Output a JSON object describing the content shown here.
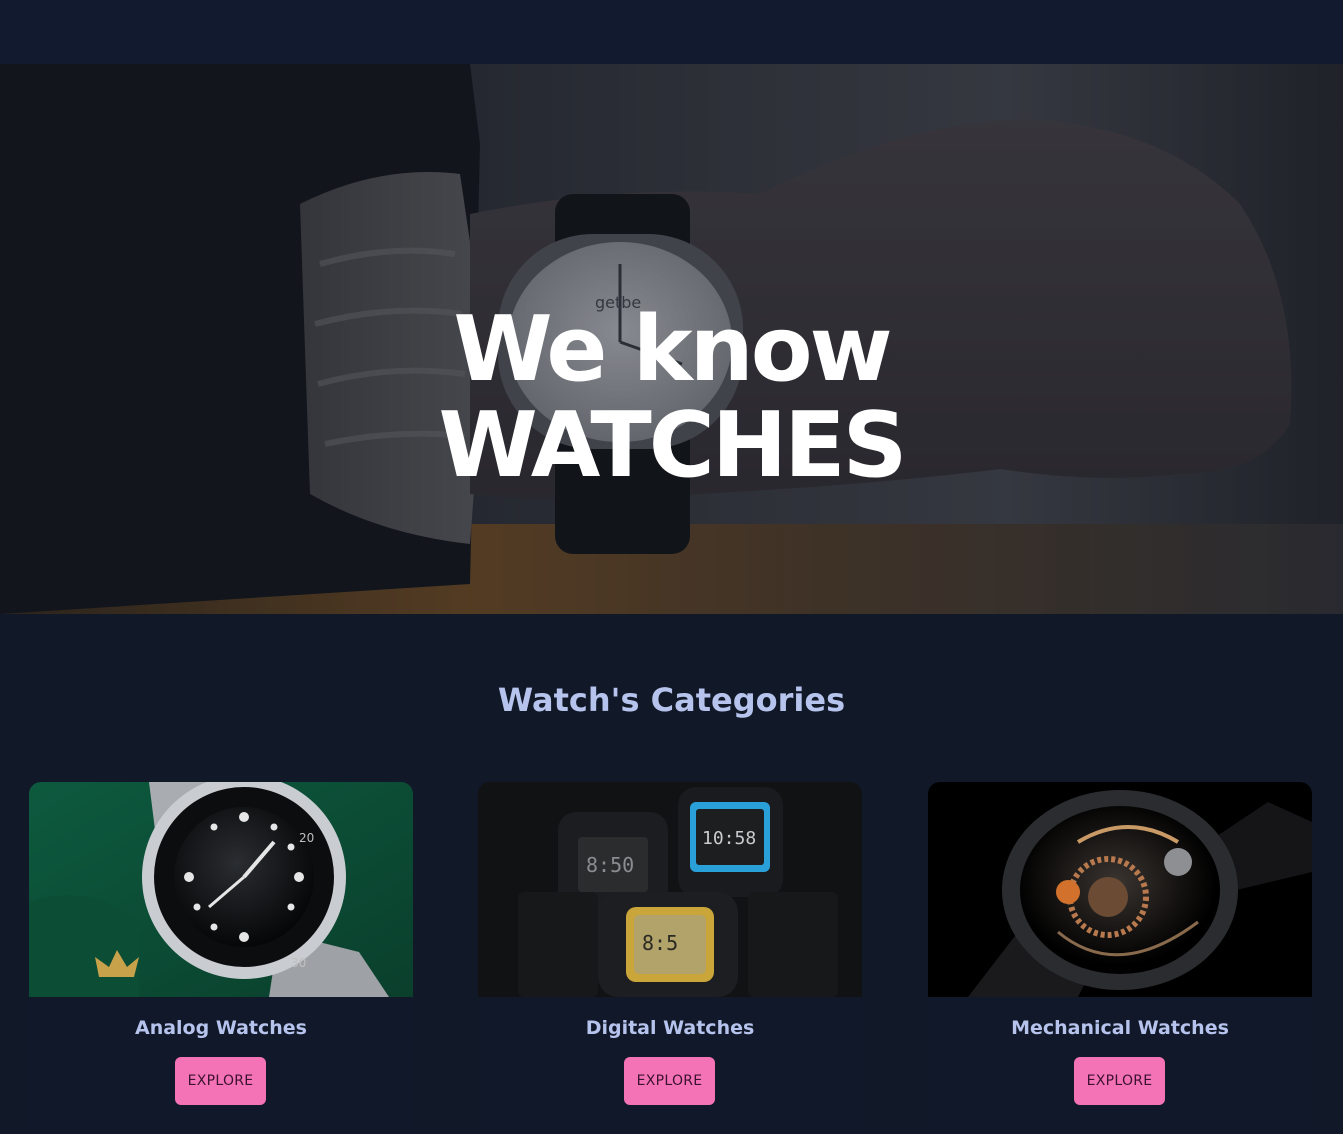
{
  "hero": {
    "title_line1": "We know",
    "title_line2": "WATCHES",
    "watch_logo_text": "getbe"
  },
  "categories": {
    "heading": "Watch's Categories",
    "items": [
      {
        "name": "Analog Watches",
        "button": "EXPLORE",
        "thumb": "analog-watch-image"
      },
      {
        "name": "Digital Watches",
        "button": "EXPLORE",
        "thumb": "digital-watch-image"
      },
      {
        "name": "Mechanical Watches",
        "button": "EXPLORE",
        "thumb": "mechanical-watch-image"
      }
    ]
  },
  "colors": {
    "page_bg": "#111827",
    "heading": "#b6c3ec",
    "button_bg": "#f472b6",
    "button_text": "#3b1230"
  }
}
